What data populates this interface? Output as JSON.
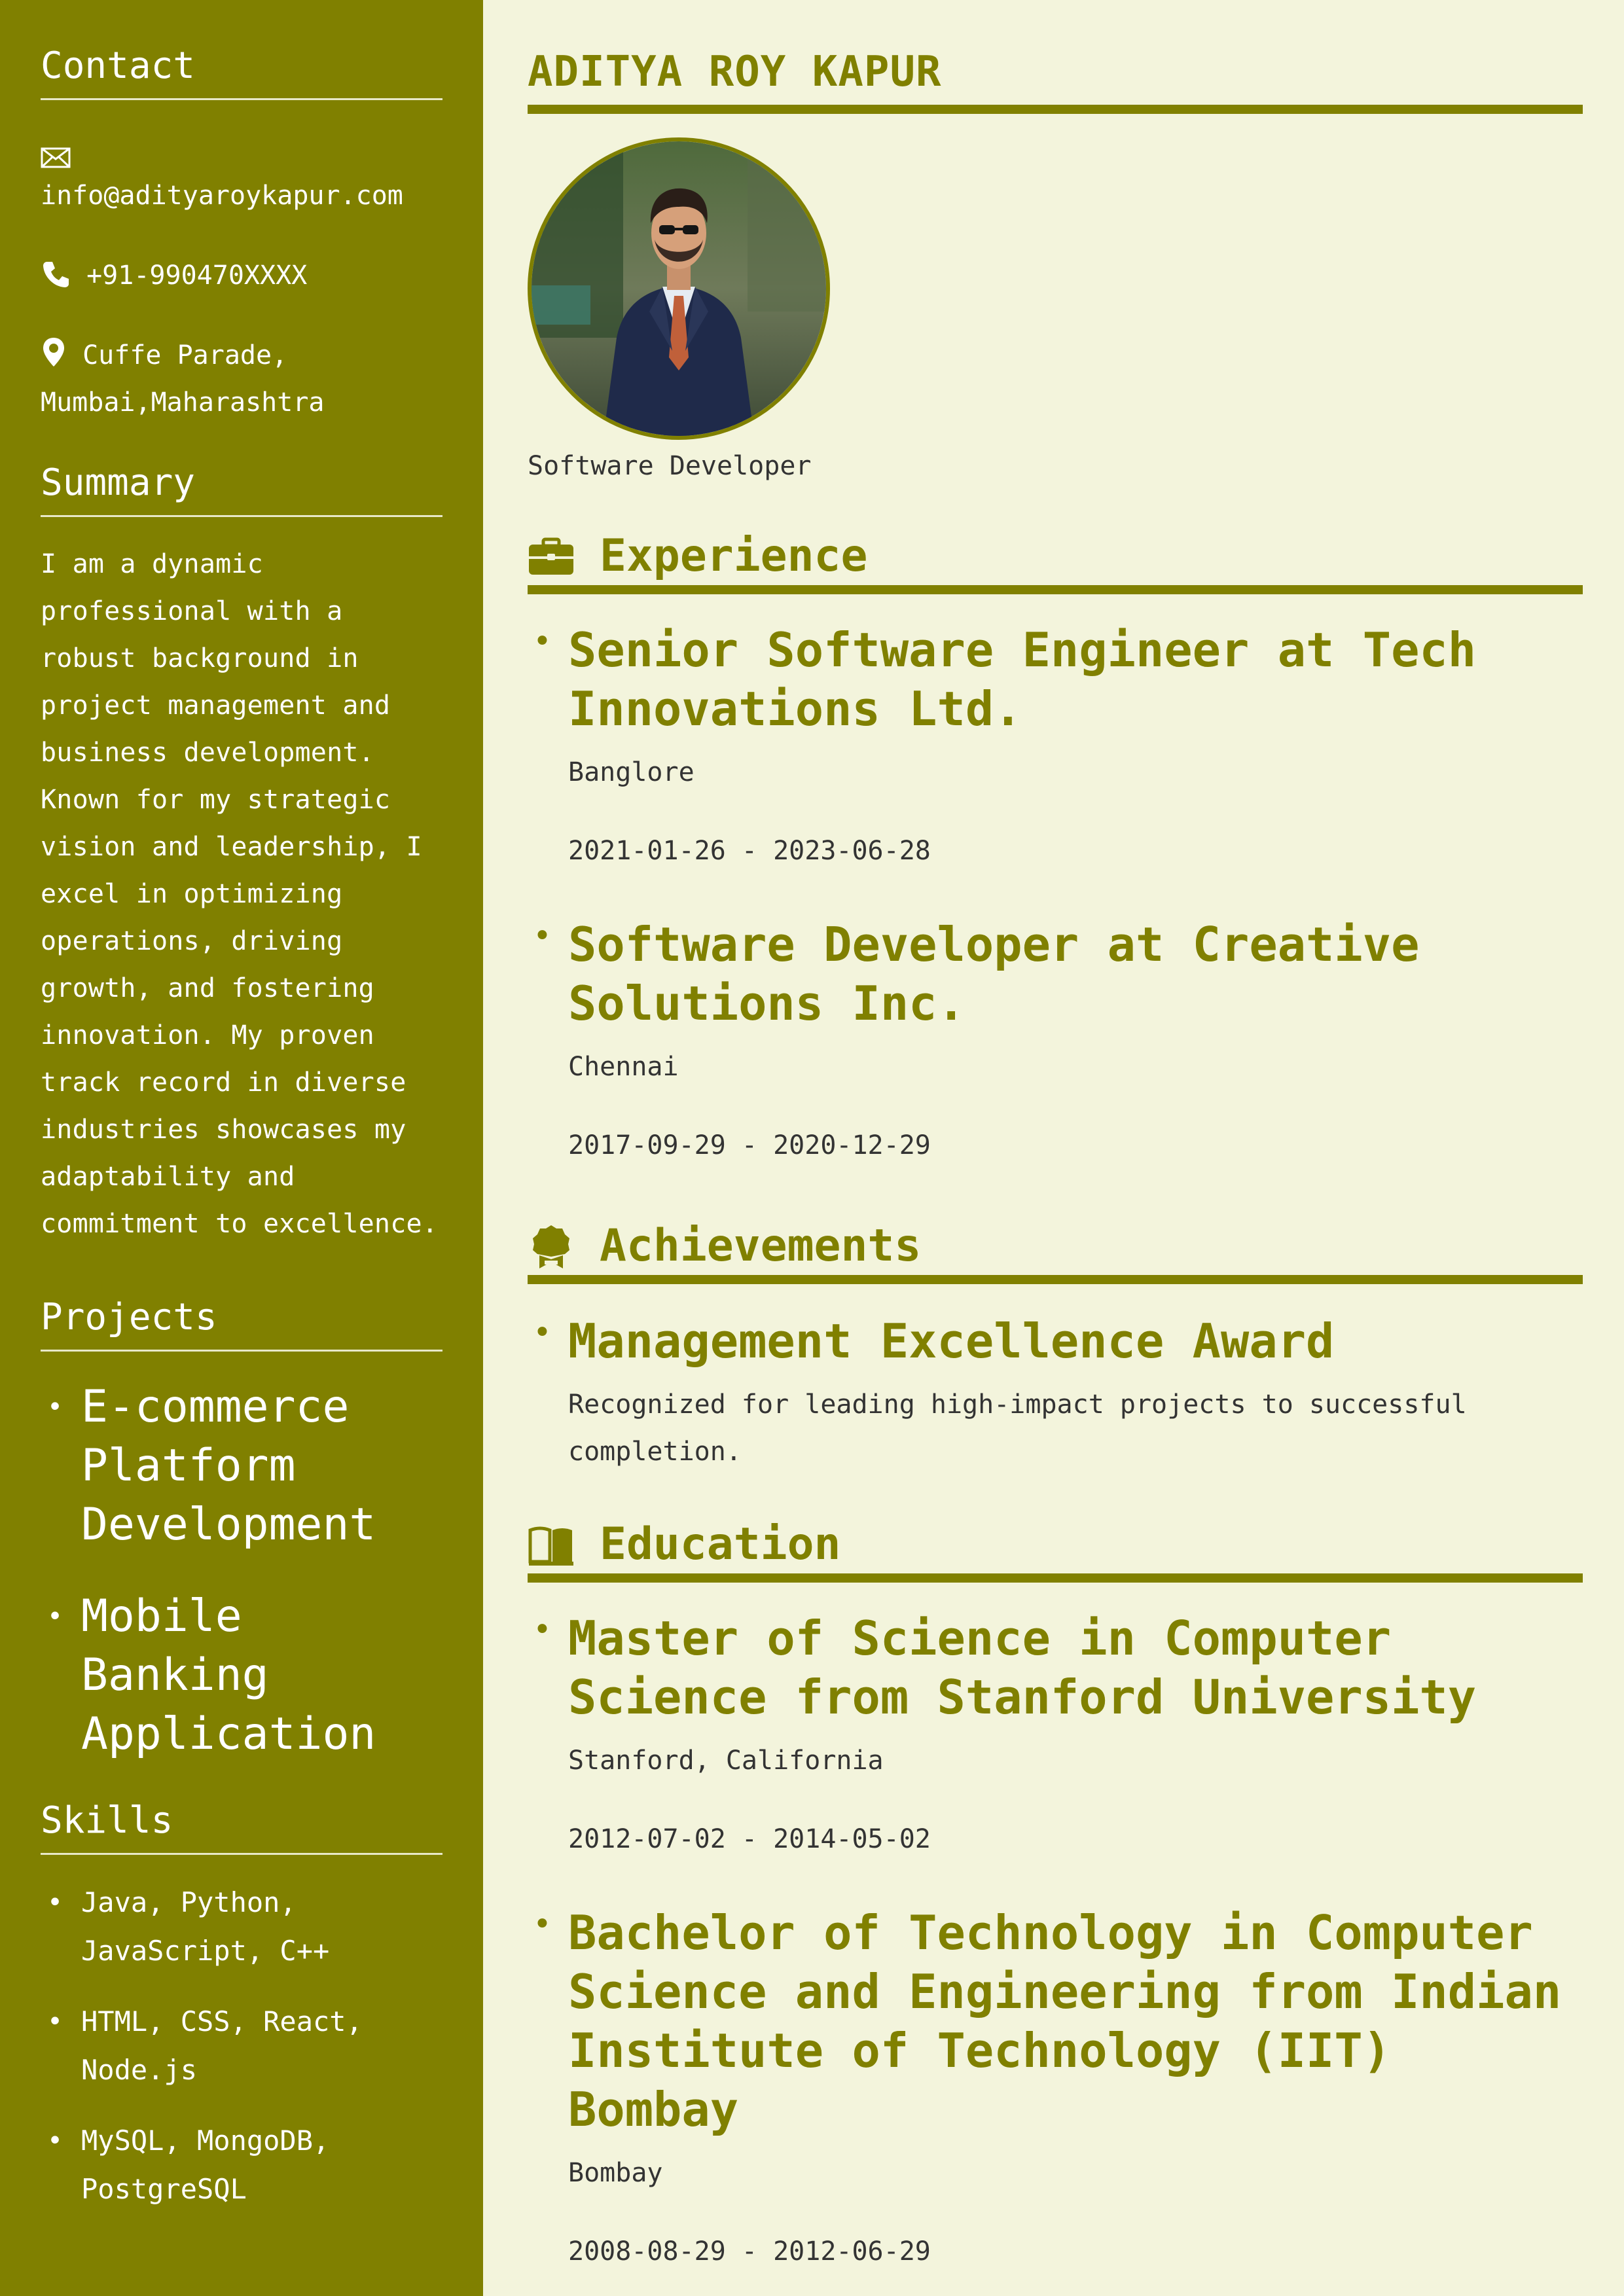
{
  "sidebar": {
    "contact": {
      "heading": "Contact",
      "email": "info@adityaroykapur.com",
      "phone": "+91-990470XXXX",
      "location_line1": "Cuffe Parade,",
      "location_line2": "Mumbai,Maharashtra"
    },
    "summary": {
      "heading": "Summary",
      "text": "I am a dynamic professional with a robust background in project management and business development. Known for my strategic vision and leadership, I excel in optimizing operations, driving growth, and fostering innovation. My proven track record in diverse industries showcases my adaptability and commitment to excellence."
    },
    "projects": {
      "heading": "Projects",
      "items": [
        "E-commerce Platform Development",
        "Mobile Banking Application"
      ]
    },
    "skills": {
      "heading": "Skills",
      "items": [
        "Java, Python, JavaScript, C++",
        "HTML, CSS, React, Node.js",
        "MySQL, MongoDB, PostgreSQL"
      ]
    }
  },
  "main": {
    "name": "ADITYA ROY KAPUR",
    "role": "Software Developer",
    "experience": {
      "heading": "Experience",
      "items": [
        {
          "title": "Senior Software Engineer at Tech Innovations Ltd.",
          "location": "Banglore",
          "dates": "2021-01-26 - 2023-06-28"
        },
        {
          "title": "Software Developer at Creative Solutions Inc.",
          "location": "Chennai",
          "dates": "2017-09-29 - 2020-12-29"
        }
      ]
    },
    "achievements": {
      "heading": "Achievements",
      "items": [
        {
          "title": "Management Excellence Award",
          "description": "Recognized for leading high-impact projects to successful completion."
        }
      ]
    },
    "education": {
      "heading": "Education",
      "items": [
        {
          "title": "Master of Science in Computer Science from Stanford University",
          "location": "Stanford, California",
          "dates": "2012-07-02 - 2014-05-02"
        },
        {
          "title": "Bachelor of Technology in Computer Science and Engineering from Indian Institute of Technology (IIT) Bombay",
          "location": "Bombay",
          "dates": "2008-08-29 - 2012-06-29"
        }
      ]
    }
  },
  "icons": {
    "email": "envelope-icon",
    "phone": "phone-icon",
    "location": "map-pin-icon",
    "experience": "briefcase-icon",
    "achievements": "award-icon",
    "education": "book-icon"
  },
  "colors": {
    "accent": "#808000",
    "page_background": "#f3f4dc",
    "body_text": "#333333",
    "sidebar_text": "#ffffff"
  }
}
